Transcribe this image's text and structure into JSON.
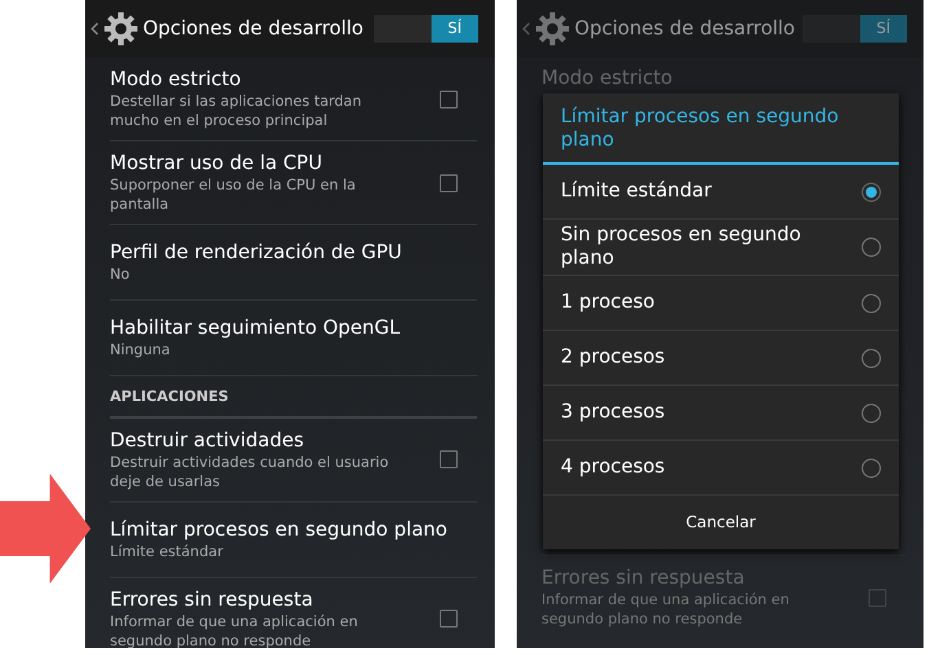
{
  "left_screen": {
    "action_bar": {
      "title": "Opciones de desarrollo",
      "switch_label": "SÍ",
      "switch_on": true
    },
    "items": [
      {
        "kind": "setting",
        "title": "Modo estricto",
        "summary": "Destellar si las aplicaciones tardan mucho en el proceso principal",
        "checked": false
      },
      {
        "kind": "setting",
        "title": "Mostrar uso de la CPU",
        "summary": "Suporponer el uso de la CPU en la pantalla",
        "checked": false
      },
      {
        "kind": "pref",
        "title": "Perfil de renderización de GPU",
        "summary": "No"
      },
      {
        "kind": "pref",
        "title": "Habilitar seguimiento OpenGL",
        "summary": "Ninguna"
      },
      {
        "kind": "header",
        "title": "APLICACIONES"
      },
      {
        "kind": "setting",
        "title": "Destruir actividades",
        "summary": "Destruir actividades cuando el usuario deje de usarlas",
        "checked": false
      },
      {
        "kind": "pref",
        "title": "Límitar procesos en segundo plano",
        "summary": "Límite estándar"
      },
      {
        "kind": "setting",
        "title": "Errores sin respuesta",
        "summary": "Informar de que una aplicación en segundo plano no responde",
        "checked": false
      }
    ]
  },
  "right_screen": {
    "action_bar": {
      "title": "Opciones de desarrollo",
      "switch_label": "SÍ",
      "switch_on": true
    },
    "background_items": [
      {
        "kind": "pref",
        "title": "Modo estricto"
      },
      {
        "kind": "setting",
        "title": "Errores sin respuesta",
        "summary": "Informar de que una aplicación en segundo plano no responde",
        "checked": false
      }
    ],
    "dialog": {
      "title": "Límitar procesos en segundo plano",
      "options": [
        {
          "label": "Límite estándar",
          "selected": true
        },
        {
          "label": "Sin procesos en segundo plano",
          "selected": false
        },
        {
          "label": "1 proceso",
          "selected": false
        },
        {
          "label": "2 procesos",
          "selected": false
        },
        {
          "label": "3 procesos",
          "selected": false
        },
        {
          "label": "4 procesos",
          "selected": false
        }
      ],
      "cancel": "Cancelar"
    }
  }
}
